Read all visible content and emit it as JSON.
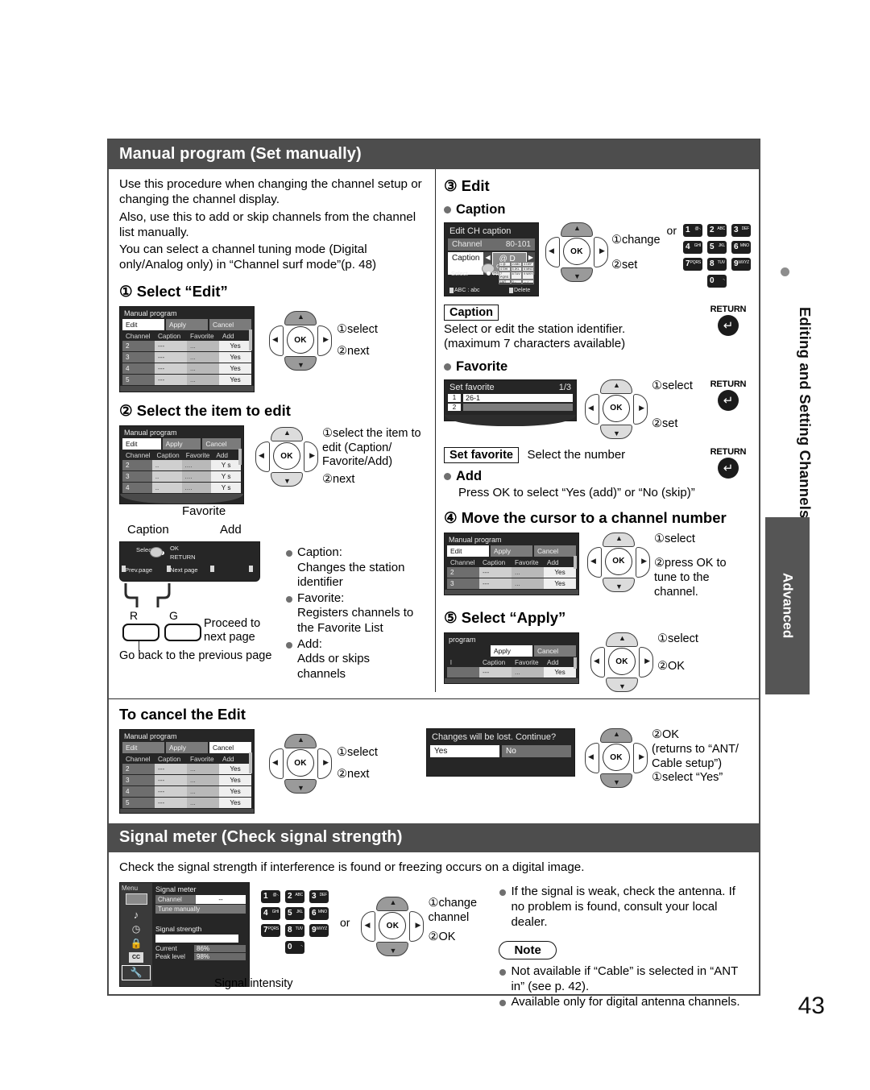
{
  "page": {
    "number": "43"
  },
  "sidebar": {
    "vertical_label": "Editing and Setting Channels",
    "tab_label": "Advanced"
  },
  "section1": {
    "header": "Manual program (Set manually)",
    "intro": [
      "Use this procedure when changing the channel setup or changing the channel display.",
      "Also, use this to add or skip channels from the channel list manually.",
      "You can select a channel tuning mode (Digital only/Analog only) in “Channel surf mode”(p. 48)"
    ],
    "step1": {
      "title": "① Select “Edit”",
      "callouts": [
        "①select",
        "②next"
      ],
      "screen": {
        "title": "Manual program",
        "tabs": [
          "Edit",
          "Apply",
          "Cancel"
        ],
        "selected_tab": "Edit",
        "headers": [
          "Channel",
          "Caption",
          "Favorite",
          "Add"
        ],
        "rows": [
          [
            "2",
            "---",
            "...",
            "Yes"
          ],
          [
            "3",
            "---",
            "...",
            "Yes"
          ],
          [
            "4",
            "---",
            "...",
            "Yes"
          ],
          [
            "5",
            "---",
            "...",
            "Yes"
          ]
        ]
      }
    },
    "step2": {
      "title": "② Select the item to edit",
      "callouts": [
        "①select the item to edit (Caption/ Favorite/Add)",
        "②next"
      ],
      "screen": {
        "title": "Manual program",
        "tabs": [
          "Edit",
          "Apply",
          "Cancel"
        ],
        "selected_tab": "Edit",
        "headers": [
          "Channel",
          "Caption",
          "Favorite",
          "Add"
        ],
        "rows": [
          [
            "2",
            "..",
            "....",
            "Y s"
          ],
          [
            "3",
            "..",
            "....",
            "Y s"
          ],
          [
            "4",
            "..",
            "....",
            "Y s"
          ]
        ]
      },
      "pointer_labels": [
        "Caption",
        "Favorite",
        "Add"
      ],
      "osd_bar": {
        "select": "Select",
        "ok": "OK",
        "return": "RETURN",
        "prev_page": "Prev.page",
        "next_page": "Next page"
      },
      "buttons": {
        "red": "R",
        "green": "G"
      },
      "green_note": "Proceed to next page",
      "red_note": "Go back to the previous page",
      "definitions": [
        {
          "term": "Caption:",
          "desc": "Changes the station identifier"
        },
        {
          "term": "Favorite:",
          "desc": "Registers channels to the Favorite List"
        },
        {
          "term": "Add:",
          "desc": "Adds or skips channels"
        }
      ]
    },
    "step3": {
      "title": "③ Edit",
      "caption_sub": "Caption",
      "screen": {
        "title": "Edit CH caption",
        "channel_label": "Channel",
        "channel_value": "80-101",
        "caption_label": "Caption",
        "caption_value": "@ D A",
        "select": "Select",
        "ok": "OK",
        "return": "RETURN",
        "abc": "ABC : abc",
        "delete": "Delete"
      },
      "callouts": [
        "①change",
        "②set"
      ],
      "or": "or",
      "keypad": [
        {
          "num": "1",
          "sub": "@-."
        },
        {
          "num": "2",
          "sub": "ABC"
        },
        {
          "num": "3",
          "sub": "DEF"
        },
        {
          "num": "4",
          "sub": "GHI"
        },
        {
          "num": "5",
          "sub": "JKL"
        },
        {
          "num": "6",
          "sub": "MNO"
        },
        {
          "num": "7",
          "sub": "PQRS"
        },
        {
          "num": "8",
          "sub": "TUV"
        },
        {
          "num": "9",
          "sub": "WXYZ"
        },
        {
          "num": "0",
          "sub": "-."
        }
      ],
      "caption_box": "Caption",
      "caption_desc1": "Select or edit the station identifier.",
      "caption_desc2": "(maximum 7 characters available)",
      "favorite_sub": "Favorite",
      "favorite_screen": {
        "title": "Set favorite",
        "page": "1/3",
        "rows": [
          {
            "num": "1",
            "value": "26-1"
          },
          {
            "num": "2",
            "value": ""
          }
        ]
      },
      "favorite_callouts": [
        "①select",
        "②set"
      ],
      "set_favorite_box": "Set favorite",
      "set_favorite_desc": "Select the number",
      "add_sub": "Add",
      "add_desc": "Press OK to select “Yes (add)” or “No (skip)”",
      "return_label": "RETURN"
    },
    "step4": {
      "title": "④ Move the cursor to a channel number",
      "callouts": [
        "①select",
        "②press OK to tune to the channel."
      ],
      "screen": {
        "title": "Manual program",
        "tabs": [
          "Edit",
          "Apply",
          "Cancel"
        ],
        "selected_tab": "Edit",
        "headers": [
          "Channel",
          "Caption",
          "Favorite",
          "Add"
        ],
        "rows": [
          [
            "2",
            "---",
            "...",
            "Yes"
          ],
          [
            "3",
            "---",
            "...",
            "Yes"
          ]
        ]
      }
    },
    "step5": {
      "title": "⑤ Select “Apply”",
      "callouts": [
        "①select",
        "②OK"
      ],
      "screen": {
        "title": "program",
        "tabs": [
          "",
          "Apply",
          "Cancel"
        ],
        "selected_tab": "Apply",
        "headers": [
          "l",
          "Caption",
          "Favorite",
          "Add"
        ],
        "rows": [
          [
            "",
            "---",
            "...",
            "Yes"
          ]
        ]
      }
    },
    "cancel": {
      "title": "To cancel the Edit",
      "callouts": [
        "①select",
        "②next"
      ],
      "screen": {
        "title": "Manual program",
        "tabs": [
          "Edit",
          "Apply",
          "Cancel"
        ],
        "selected_tab": "Cancel",
        "headers": [
          "Channel",
          "Caption",
          "Favorite",
          "Add"
        ],
        "rows": [
          [
            "2",
            "---",
            "...",
            "Yes"
          ],
          [
            "3",
            "---",
            "...",
            "Yes"
          ],
          [
            "4",
            "---",
            "...",
            "Yes"
          ],
          [
            "5",
            "---",
            "...",
            "Yes"
          ]
        ]
      },
      "dialog": {
        "message": "Changes will be lost. Continue?",
        "yes": "Yes",
        "no": "No"
      },
      "dialog_callouts": [
        "②OK",
        "(returns to “ANT/ Cable setup”)",
        "①select “Yes”"
      ]
    }
  },
  "section2": {
    "header": "Signal meter (Check signal strength)",
    "intro": "Check the signal strength if interference is found or freezing occurs on a digital image.",
    "screen": {
      "menu_label": "Menu",
      "title": "Signal meter",
      "channel_label": "Channel",
      "channel_value": "--",
      "tune_manually": "Tune manually",
      "strength_label": "Signal strength",
      "current_label": "Current",
      "current_value": "86%",
      "peak_label": "Peak level",
      "peak_value": "98%",
      "menu_icons": [
        "picture-icon",
        "audio-note-icon",
        "timer-icon",
        "lock-icon",
        "cc-icon",
        "setup-wrench-icon"
      ]
    },
    "signal_intensity_label": "Signal intensity",
    "or": "or",
    "callouts": [
      "①change channel",
      "②OK"
    ],
    "keypad": [
      {
        "num": "1",
        "sub": "@-."
      },
      {
        "num": "2",
        "sub": "ABC"
      },
      {
        "num": "3",
        "sub": "DEF"
      },
      {
        "num": "4",
        "sub": "GHI"
      },
      {
        "num": "5",
        "sub": "JKL"
      },
      {
        "num": "6",
        "sub": "MNO"
      },
      {
        "num": "7",
        "sub": "PQRS"
      },
      {
        "num": "8",
        "sub": "TUV"
      },
      {
        "num": "9",
        "sub": "WXYZ"
      },
      {
        "num": "0",
        "sub": "-."
      }
    ],
    "bullets": [
      "If the signal is weak, check the antenna. If no problem is found, consult your local dealer."
    ],
    "note_label": "Note",
    "notes": [
      "Not available if “Cable” is selected in “ANT in” (see p. 42).",
      "Available only for digital antenna channels."
    ]
  }
}
